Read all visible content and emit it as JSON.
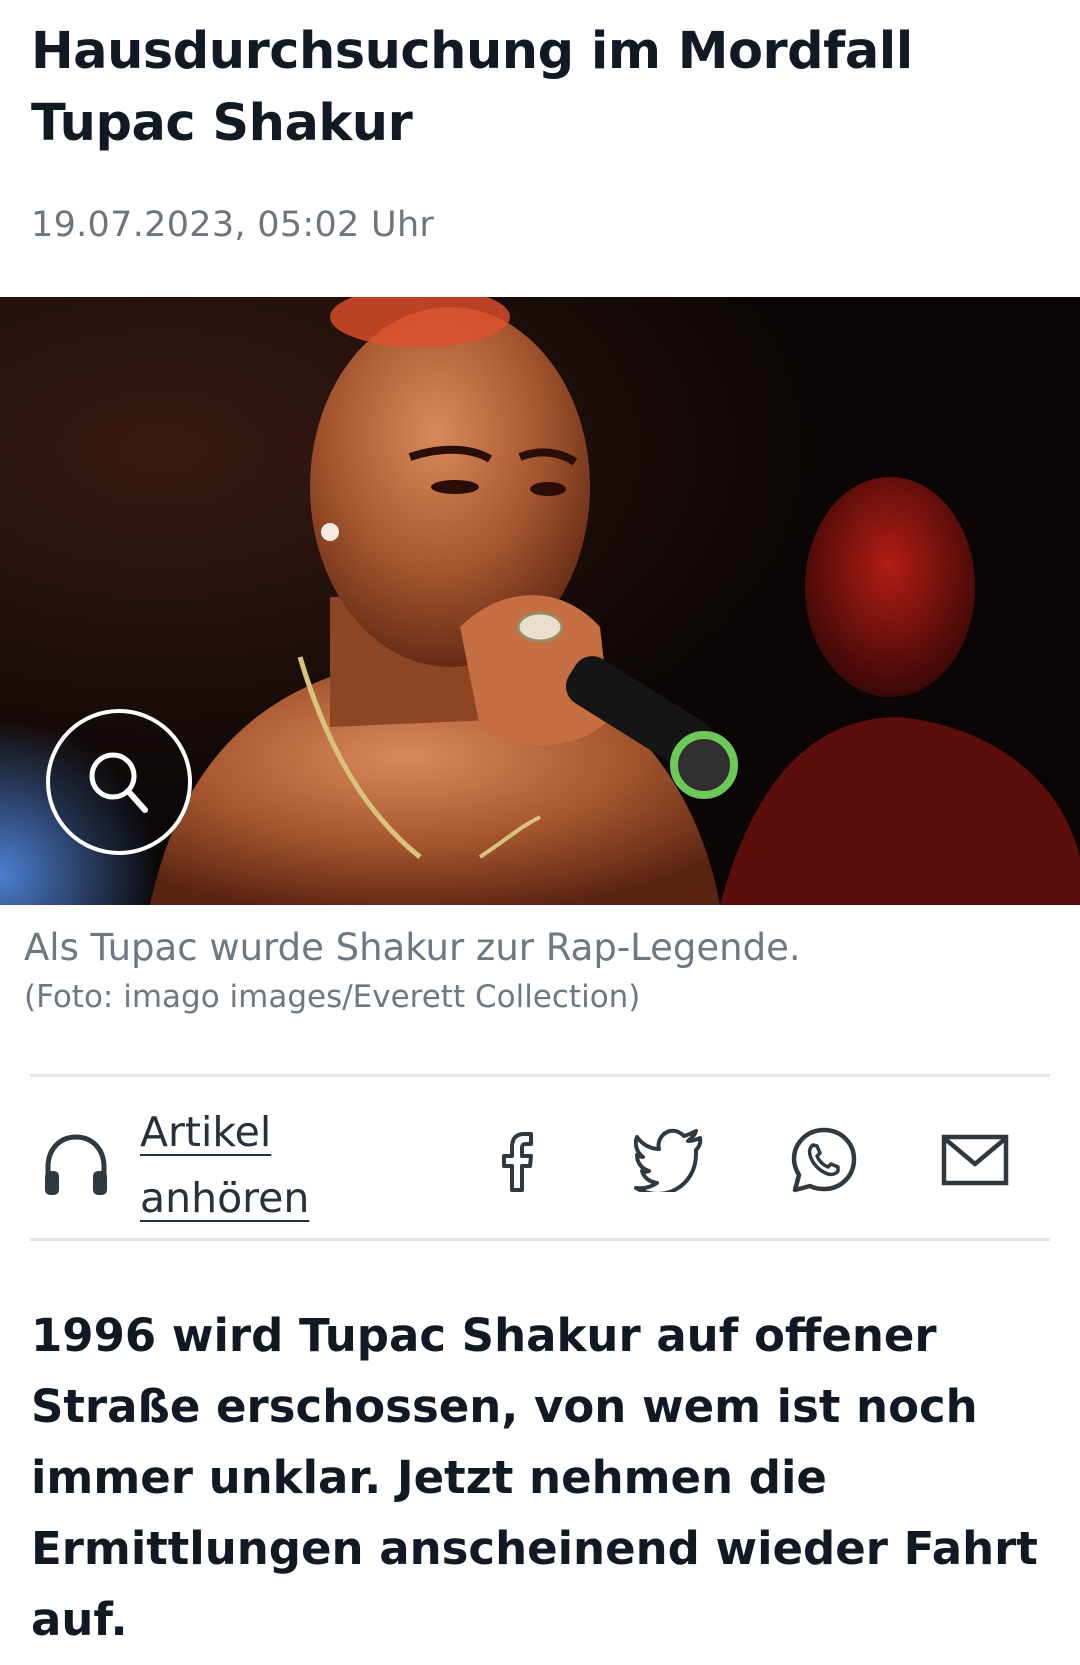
{
  "article": {
    "headline": "Hausdurchsuchung im Mordfall Tupac Shakur",
    "date": "19.07.2023, 05:02 Uhr",
    "image": {
      "alt": "Tupac Shakur rappt auf der Bühne ins Mikrofon",
      "zoom_icon": "search-icon"
    },
    "caption": "Als Tupac wurde Shakur zur Rap-Legende.",
    "credit": "(Foto: imago images/Everett Collection)",
    "lead": "1996 wird Tupac Shakur auf offener Straße erschossen, von wem ist noch immer unklar. Jetzt nehmen die Ermittlungen anscheinend wieder Fahrt auf."
  },
  "actions": {
    "listen_label": "Artikel anhören",
    "listen_icon": "headphones-icon",
    "share": [
      {
        "name": "facebook",
        "icon": "facebook-icon"
      },
      {
        "name": "twitter",
        "icon": "twitter-icon"
      },
      {
        "name": "whatsapp",
        "icon": "whatsapp-icon"
      },
      {
        "name": "email",
        "icon": "mail-icon"
      }
    ]
  },
  "colors": {
    "text": "#111a24",
    "meta": "#6e757c",
    "divider": "#e2e5e8",
    "icon": "#2f3942"
  }
}
